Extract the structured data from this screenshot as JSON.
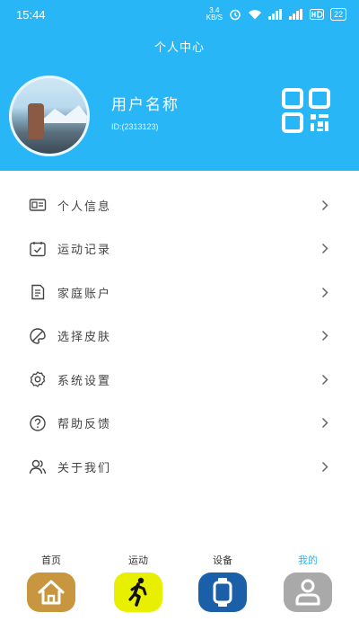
{
  "status": {
    "time": "15:44",
    "speed_top": "3.4",
    "speed_bottom": "KB/S",
    "battery": "22"
  },
  "header": {
    "title": "个人中心",
    "user_name": "用户名称",
    "user_id": "ID:(2313123)"
  },
  "menu": {
    "items": [
      {
        "label": "个人信息",
        "icon": "id-card-icon"
      },
      {
        "label": "运动记录",
        "icon": "calendar-icon"
      },
      {
        "label": "家庭账户",
        "icon": "document-icon"
      },
      {
        "label": "选择皮肤",
        "icon": "palette-icon"
      },
      {
        "label": "系统设置",
        "icon": "gear-icon"
      },
      {
        "label": "帮助反馈",
        "icon": "help-icon"
      },
      {
        "label": "关于我们",
        "icon": "users-icon"
      }
    ]
  },
  "tabs": [
    {
      "label": "首页",
      "icon": "home-icon",
      "color": "#c8963e"
    },
    {
      "label": "运动",
      "icon": "running-icon",
      "color": "#e8f000"
    },
    {
      "label": "设备",
      "icon": "watch-icon",
      "color": "#1a5fa8"
    },
    {
      "label": "我的",
      "icon": "user-icon",
      "color": "#a9a9a9",
      "active": true
    }
  ],
  "colors": {
    "header_bg": "#29b6f6",
    "active_tab": "#29b6f6"
  }
}
